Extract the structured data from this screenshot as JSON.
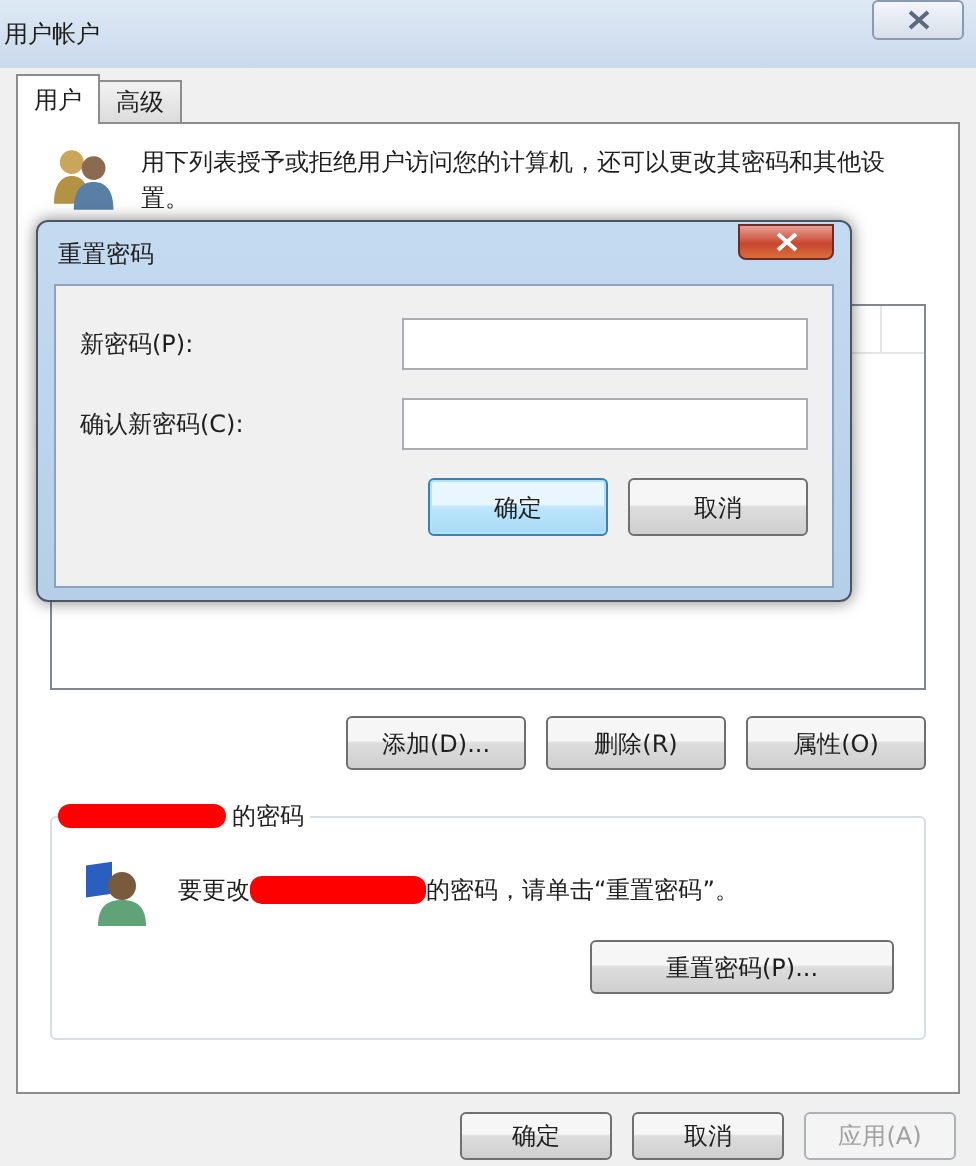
{
  "window": {
    "title": "用户帐户"
  },
  "tabs": [
    {
      "label": "用户",
      "selected": true
    },
    {
      "label": "高级",
      "selected": false
    }
  ],
  "intro": "用下列表授予或拒绝用户访问您的计算机，还可以更改其密码和其他设置。",
  "list_buttons": [
    "添加(D)...",
    "删除(R)",
    "属性(O)"
  ],
  "password_group": {
    "title": "的密码",
    "message_before": "要更改",
    "message_after": "的密码，请单击“重置密码”。",
    "reset_button": "重置密码(P)..."
  },
  "footer_buttons": [
    {
      "label": "确定",
      "disabled": false
    },
    {
      "label": "取消",
      "disabled": false
    },
    {
      "label": "应用(A)",
      "disabled": true
    }
  ],
  "dialog": {
    "title": "重置密码",
    "fields": [
      {
        "label": "新密码(P):"
      },
      {
        "label": "确认新密码(C):"
      }
    ],
    "buttons": [
      {
        "label": "确定",
        "default": true
      },
      {
        "label": "取消",
        "default": false
      }
    ]
  }
}
